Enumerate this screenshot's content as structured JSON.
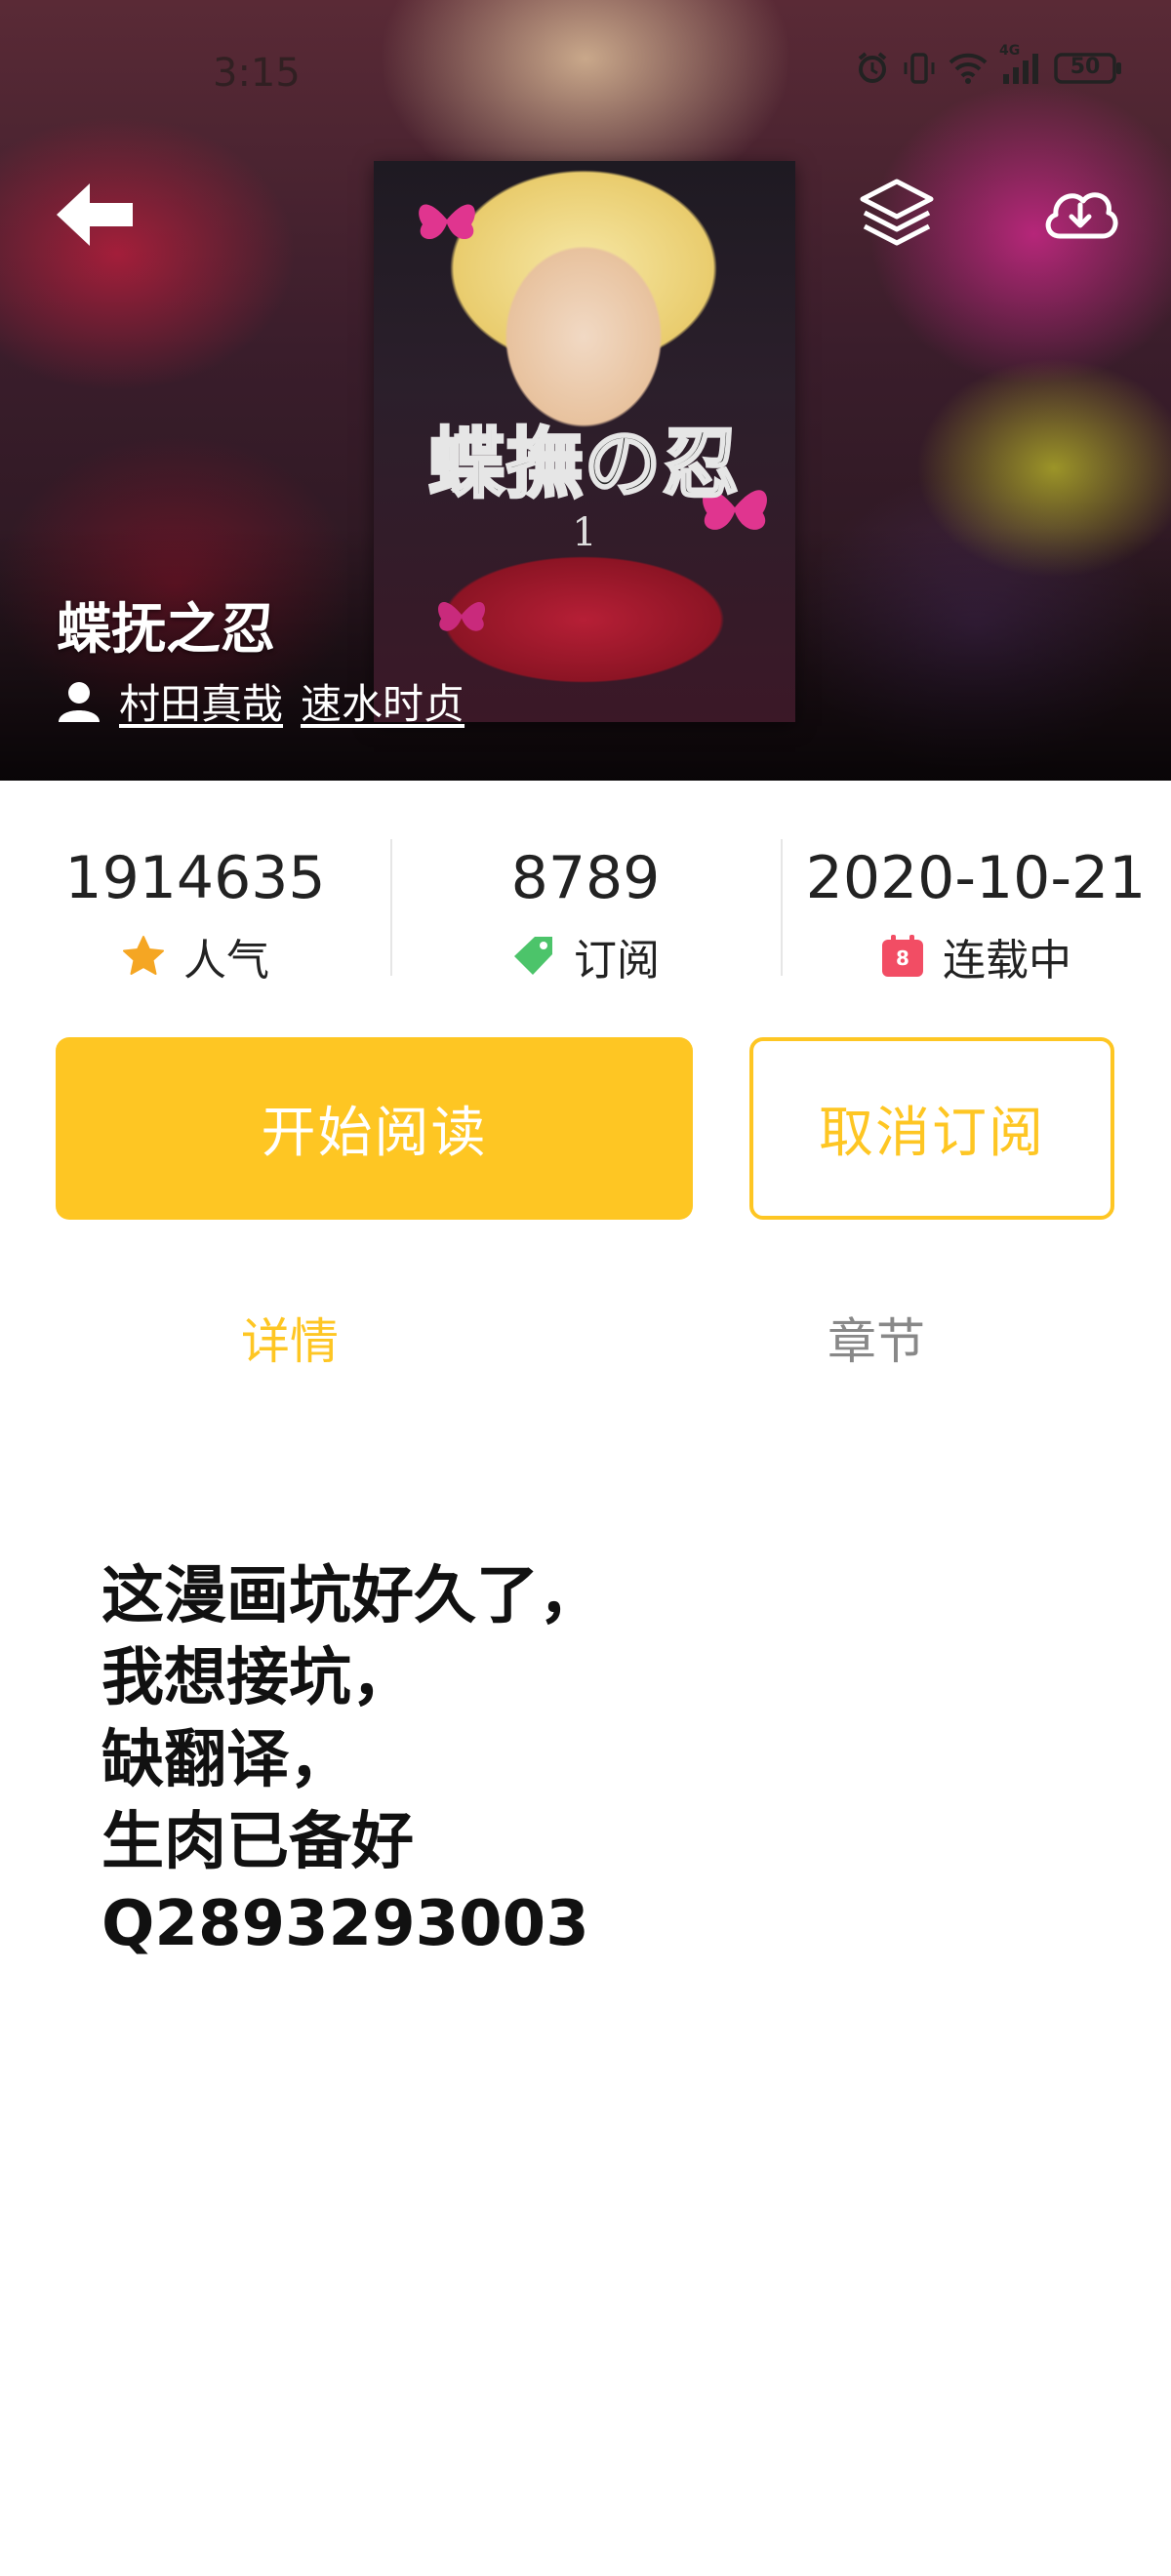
{
  "status_bar": {
    "time": "3:15",
    "network": "4G",
    "battery": "50"
  },
  "hero": {
    "title": "蝶抚之忍",
    "authors": [
      "村田真哉",
      "速水时贞"
    ],
    "cover": {
      "title": "蝶撫の忍",
      "volume": "1"
    }
  },
  "stats": [
    {
      "value": "1914635",
      "label": "人气",
      "icon": "star-icon",
      "icon_color": "#f5a623"
    },
    {
      "value": "8789",
      "label": "订阅",
      "icon": "tag-icon",
      "icon_color": "#4cc46a"
    },
    {
      "value": "2020-10-21",
      "label": "连载中",
      "icon": "calendar-icon",
      "icon_color": "#f24d64",
      "icon_text": "8"
    }
  ],
  "actions": {
    "read_label": "开始阅读",
    "unsubscribe_label": "取消订阅"
  },
  "tabs": [
    {
      "label": "详情",
      "active": true
    },
    {
      "label": "章节",
      "active": false
    }
  ],
  "description": [
    "这漫画坑好久了，",
    "我想接坑，",
    "缺翻译，",
    "生肉已备好",
    "Q2893293003"
  ],
  "colors": {
    "accent": "#fec623",
    "inactive_tab": "#888888"
  }
}
